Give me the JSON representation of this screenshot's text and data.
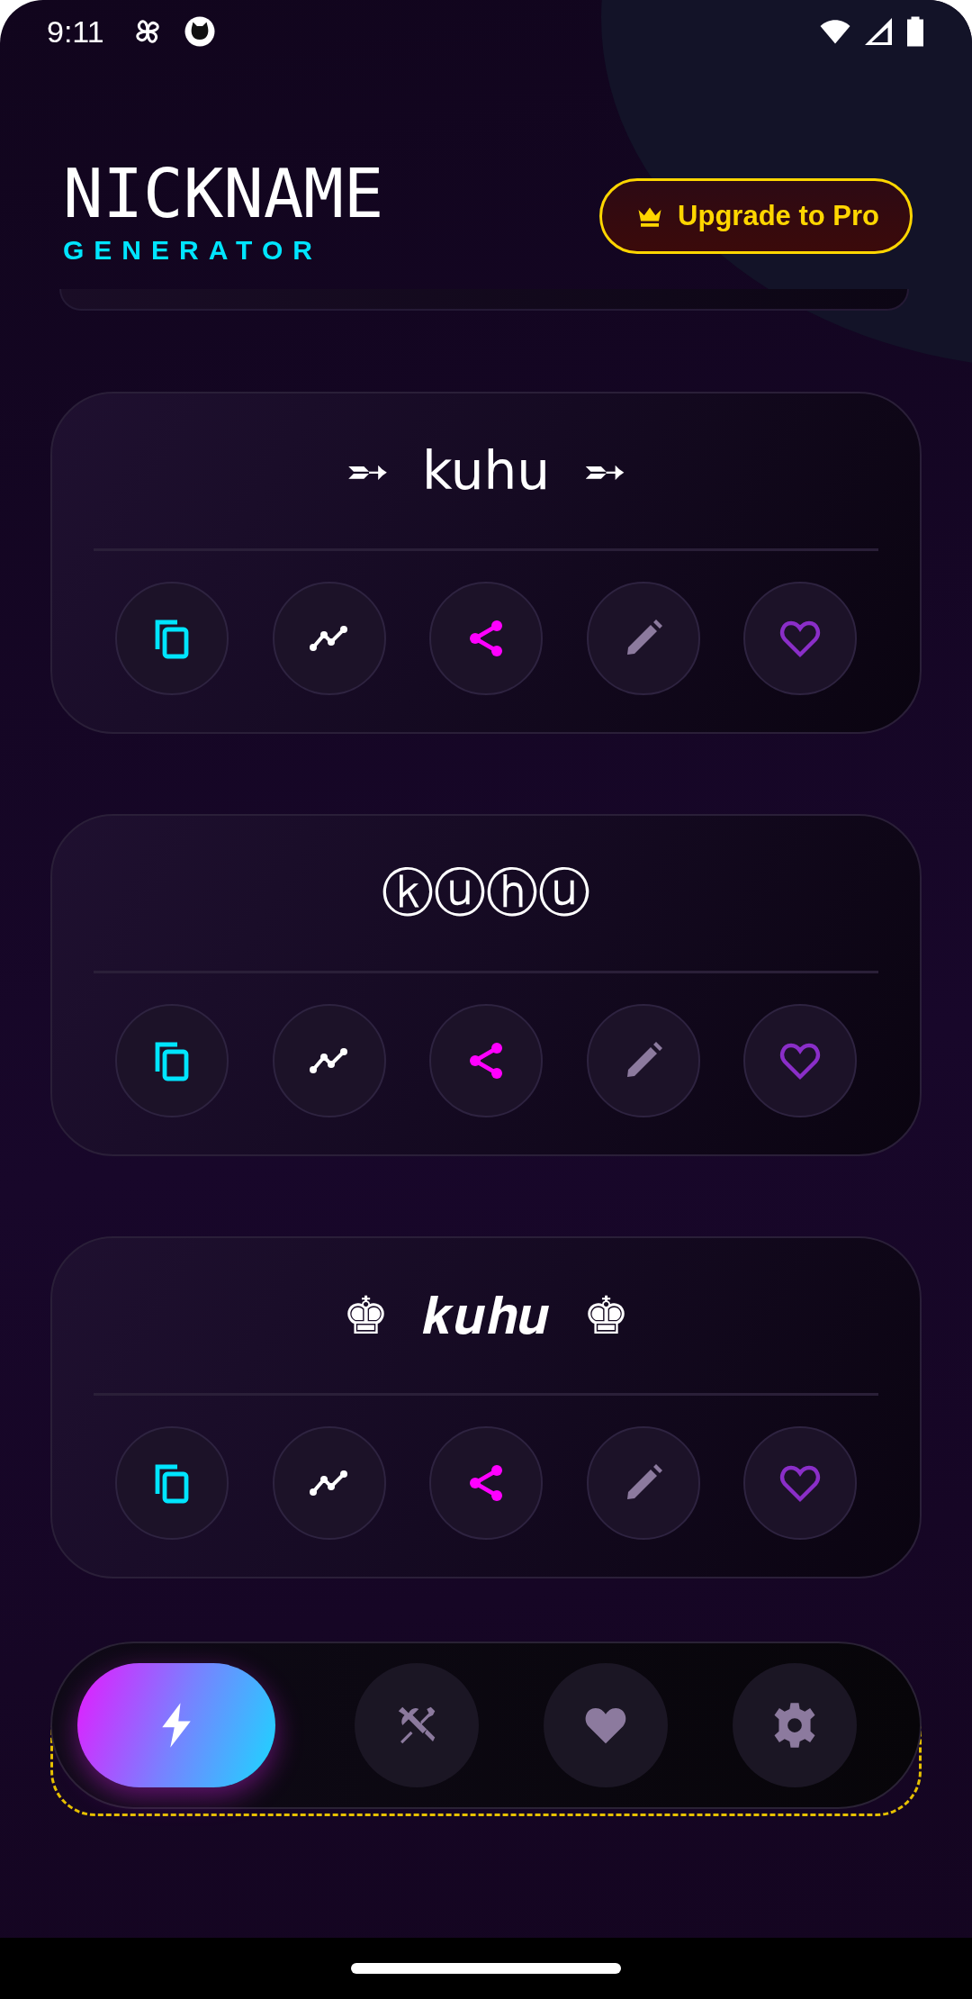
{
  "status_bar": {
    "time": "9:11"
  },
  "header": {
    "title": "NICKNAME",
    "subtitle": "GENERATOR",
    "upgrade_button": "Upgrade to Pro"
  },
  "results": [
    {
      "nickname": "➵ kuhu ➵"
    },
    {
      "nickname": "ⓚⓤⓗⓤ"
    },
    {
      "nickname": "♚ 𝒌𝒖𝒉𝒖 ♚"
    }
  ],
  "nav": [
    {
      "kind": "generate",
      "selected": true
    },
    {
      "kind": "tools",
      "selected": false
    },
    {
      "kind": "favorites",
      "selected": false
    },
    {
      "kind": "settings",
      "selected": false
    }
  ]
}
